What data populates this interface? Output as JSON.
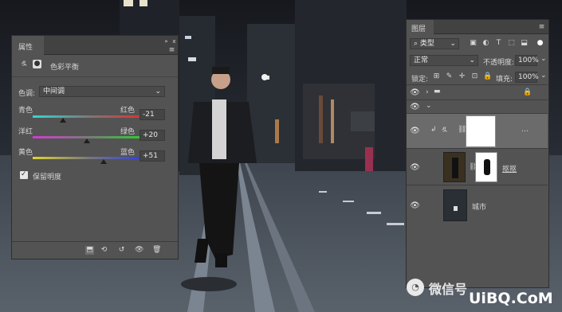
{
  "properties_panel": {
    "tab_label": "属性",
    "adjustment_name": "色彩平衡",
    "tone_label": "色调:",
    "tone_value": "中间调",
    "sliders": [
      {
        "left_label": "青色",
        "right_label": "红色",
        "value": "-21",
        "level": -21
      },
      {
        "left_label": "洋红",
        "right_label": "绿色",
        "value": "+20",
        "level": 20
      },
      {
        "left_label": "黄色",
        "right_label": "蓝色",
        "value": "+51",
        "level": 51
      }
    ],
    "preserve_luminosity_label": "保留明度",
    "preserve_luminosity_checked": true
  },
  "layers_panel": {
    "tab_label": "图层",
    "filter_kind": "类型",
    "blend_mode": "正常",
    "opacity_label": "不透明度:",
    "opacity_value": "100%",
    "lock_label": "锁定:",
    "fill_label": "填充:",
    "fill_value": "100%",
    "layers": [
      {
        "name": "",
        "type": "group"
      },
      {
        "name": "",
        "type": "adjustment-color-balance"
      },
      {
        "name": "抠抠",
        "type": "pixel-with-mask"
      },
      {
        "name": "城市",
        "type": "pixel"
      }
    ]
  },
  "watermark": {
    "text": "微信号",
    "logo": "UiBQ.CoM"
  },
  "colors": {
    "panel_bg": "#535353",
    "panel_dark": "#424242",
    "selected_row": "#6b6b6b"
  }
}
